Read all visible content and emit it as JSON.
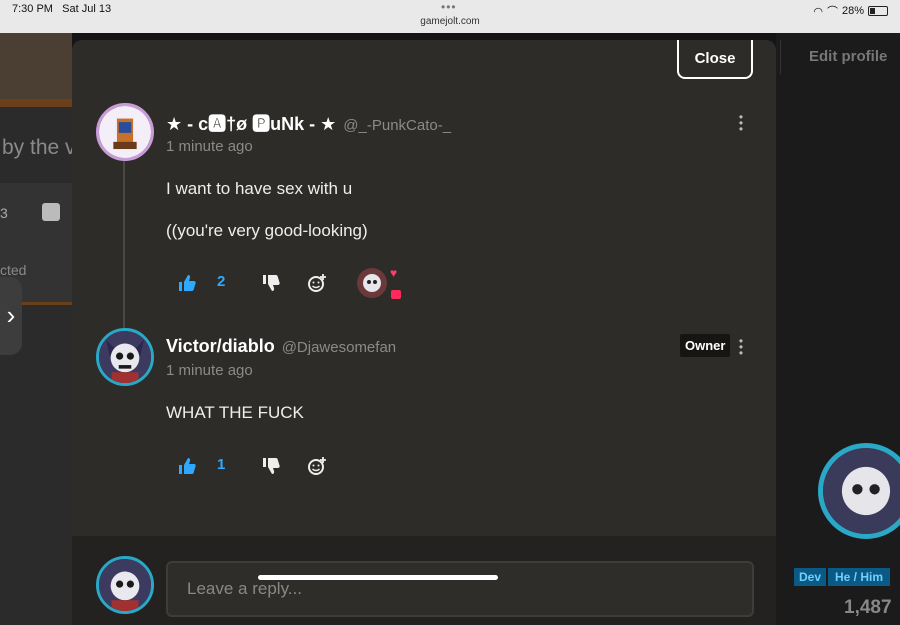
{
  "status_bar": {
    "time": "7:30 PM",
    "date": "Sat Jul 13",
    "url": "gamejolt.com",
    "battery": "28%"
  },
  "background": {
    "left_text": "by the v",
    "left_count": "3",
    "left_partial": "cted",
    "edit_profile": "Edit profile",
    "tag_dev": "Dev",
    "tag_pronouns": "He / Him",
    "count": "1,487"
  },
  "modal": {
    "close_label": "Close"
  },
  "comment": {
    "display_name": "★ - c🅰†ø 🅿uNk - ★",
    "handle": "@_-PunkCato-_",
    "timestamp": "1 minute ago",
    "lines": [
      "I want to have sex with u",
      "((you're very good-looking)"
    ],
    "like_count": "2"
  },
  "reply": {
    "display_name": "Victor/diablo",
    "handle": "@Djawesomefan",
    "badge": "Owner",
    "timestamp": "1 minute ago",
    "text": "WHAT THE FUCK",
    "like_count": "1"
  },
  "reply_box": {
    "placeholder": "Leave a reply..."
  },
  "colors": {
    "modal_bg": "#2e2c29",
    "accent_blue": "#2fa8ff",
    "avatar_ring": "#29a9c7",
    "reaction_pink": "#ff3e6a"
  }
}
